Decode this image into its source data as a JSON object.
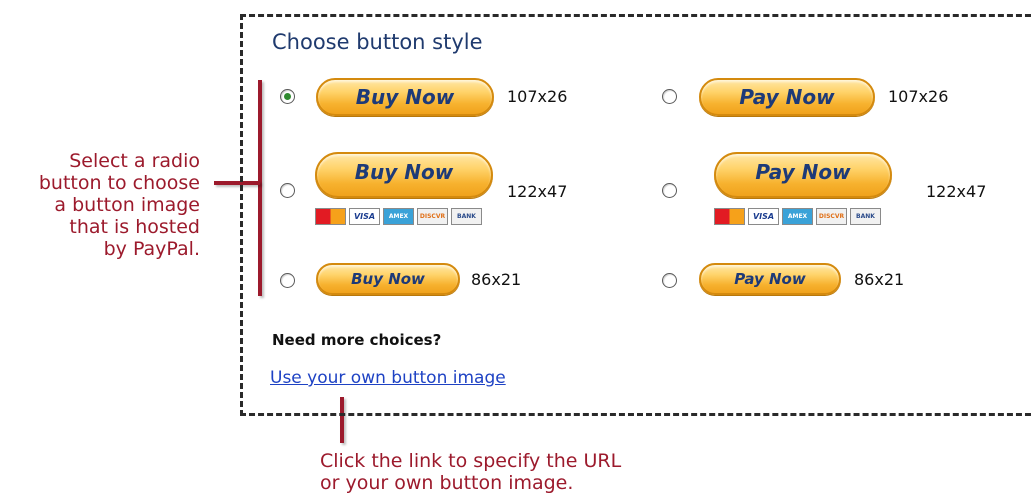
{
  "panel": {
    "title": "Choose button style",
    "need_more": "Need more choices?",
    "custom_link": "Use your own button image"
  },
  "options": [
    {
      "label": "Buy Now",
      "size": "107x26",
      "selected": true
    },
    {
      "label": "Pay Now",
      "size": "107x26",
      "selected": false
    },
    {
      "label": "Buy Now",
      "size": "122x47",
      "selected": false
    },
    {
      "label": "Pay Now",
      "size": "122x47",
      "selected": false
    },
    {
      "label": "Buy Now",
      "size": "86x21",
      "selected": false
    },
    {
      "label": "Pay Now",
      "size": "86x21",
      "selected": false
    }
  ],
  "cards": {
    "visa": "VISA",
    "amex": "AMEX",
    "discover": "DISCVR",
    "bank": "BANK"
  },
  "annotations": {
    "left": [
      "Select a radio",
      "button to choose",
      "a button image",
      "that is hosted",
      "by PayPal."
    ],
    "bottom": [
      "Click the link to specify the URL",
      "or your own button image."
    ]
  },
  "colors": {
    "annotation": "#9c1a2c",
    "title": "#1f3a6e",
    "link": "#1e42c4",
    "button_text": "#1d3a78"
  }
}
